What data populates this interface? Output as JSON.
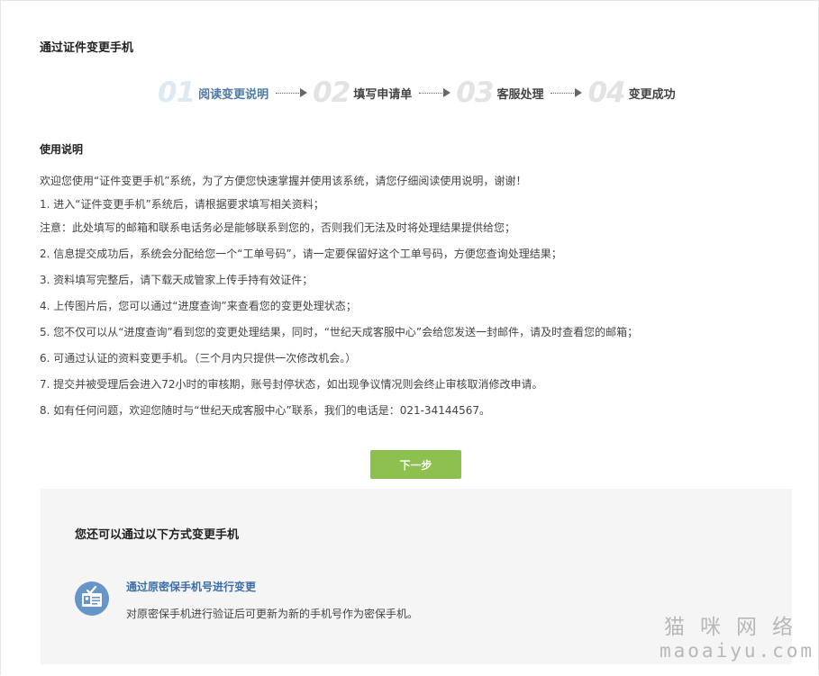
{
  "page": {
    "title": "通过证件变更手机"
  },
  "steps": [
    {
      "num": "01",
      "label": "阅读变更说明",
      "active": true
    },
    {
      "num": "02",
      "label": "填写申请单",
      "active": false
    },
    {
      "num": "03",
      "label": "客服处理",
      "active": false
    },
    {
      "num": "04",
      "label": "变更成功",
      "active": false
    }
  ],
  "instructions": {
    "title": "使用说明",
    "lines": [
      "欢迎您使用“证件变更手机”系统，为了方便您快速掌握并使用该系统，请您仔细阅读使用说明，谢谢！",
      "1. 进入“证件变更手机”系统后，请根据要求填写相关资料；",
      "注意：此处填写的邮箱和联系电话务必是能够联系到您的，否则我们无法及时将处理结果提供给您；",
      "2. 信息提交成功后，系统会分配给您一个“工单号码”，请一定要保留好这个工单号码，方便您查询处理结果；",
      "3. 资料填写完整后，请下载天成管家上传手持有效证件；",
      "4. 上传图片后，您可以通过“进度查询”来查看您的变更处理状态；",
      "5. 您不仅可以从“进度查询”看到您的变更处理结果，同时，“世纪天成客服中心”会给您发送一封邮件，请及时查看您的邮箱；",
      "6. 可通过认证的资料变更手机。（三个月内只提供一次修改机会。）",
      "7. 提交并被受理后会进入72小时的审核期，账号封停状态，如出现争议情况则会终止审核取消修改申请。",
      "8. 如有任何问题，欢迎您随时与“世纪天成客服中心”联系，我们的电话是：021-34144567。"
    ]
  },
  "next_button": {
    "label": "下一步",
    "color": "#8dc04f"
  },
  "alternatives": {
    "title": "您还可以通过以下方式变更手机",
    "items": [
      {
        "icon": "id-card-check-icon",
        "link": "通过原密保手机号进行变更",
        "description": "对原密保手机进行验证后可更新为新的手机号作为密保手机。"
      }
    ]
  },
  "watermark": {
    "cn": "猫咪网络",
    "en": "maoaiyu.com"
  },
  "colors": {
    "accent_blue": "#4d7aa6",
    "link_blue": "#3d6ea8",
    "panel_bg": "#f5f5f5",
    "icon_bg": "#6595c9"
  }
}
